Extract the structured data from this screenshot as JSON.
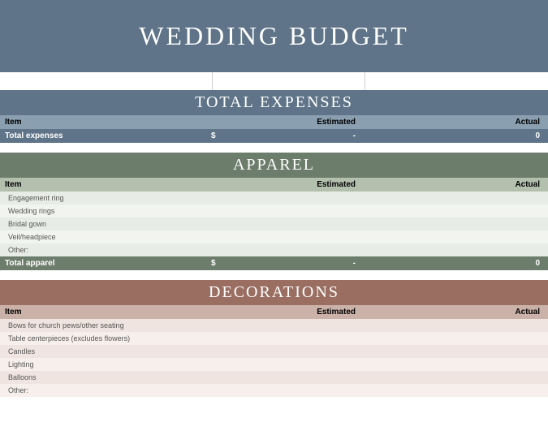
{
  "title": "WEDDING BUDGET",
  "columns": {
    "item": "Item",
    "estimated": "Estimated",
    "actual": "Actual"
  },
  "total_expenses": {
    "heading": "TOTAL EXPENSES",
    "total_row": {
      "label": "Total expenses",
      "currency": "$",
      "estimated": "-",
      "actual": "0"
    }
  },
  "apparel": {
    "heading": "APPAREL",
    "items": [
      {
        "label": "Engagement ring",
        "estimated": "",
        "actual": ""
      },
      {
        "label": "Wedding rings",
        "estimated": "",
        "actual": ""
      },
      {
        "label": "Bridal gown",
        "estimated": "",
        "actual": ""
      },
      {
        "label": "Veil/headpiece",
        "estimated": "",
        "actual": ""
      },
      {
        "label": "Other:",
        "estimated": "",
        "actual": ""
      }
    ],
    "total_row": {
      "label": "Total apparel",
      "currency": "$",
      "estimated": "-",
      "actual": "0"
    }
  },
  "decorations": {
    "heading": "DECORATIONS",
    "items": [
      {
        "label": "Bows for church pews/other seating",
        "estimated": "",
        "actual": ""
      },
      {
        "label": "Table centerpieces (excludes flowers)",
        "estimated": "",
        "actual": ""
      },
      {
        "label": "Candles",
        "estimated": "",
        "actual": ""
      },
      {
        "label": "Lighting",
        "estimated": "",
        "actual": ""
      },
      {
        "label": "Balloons",
        "estimated": "",
        "actual": ""
      },
      {
        "label": "Other:",
        "estimated": "",
        "actual": ""
      }
    ]
  }
}
